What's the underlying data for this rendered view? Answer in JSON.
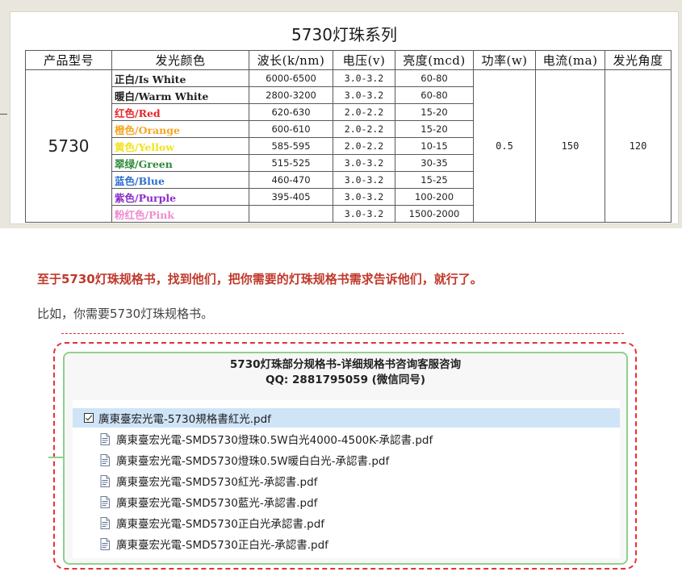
{
  "spec_table": {
    "title": "5730灯珠系列",
    "headers": [
      "产品型号",
      "发光颜色",
      "波长(k/nm)",
      "电压(v)",
      "亮度(mcd)",
      "功率(w)",
      "电流(ma)",
      "发光角度"
    ],
    "model": "5730",
    "power": "0.5",
    "current": "150",
    "angle": "120",
    "rows": [
      {
        "color": "正白/Is White",
        "color_hex": "#222222",
        "wavelength": "6000-6500",
        "voltage": "3.0-3.2",
        "brightness": "60-80"
      },
      {
        "color": "暖白/Warm White",
        "color_hex": "#222222",
        "wavelength": "2800-3200",
        "voltage": "3.0-3.2",
        "brightness": "60-80"
      },
      {
        "color": "红色/Red",
        "color_hex": "#e8262a",
        "wavelength": "620-630",
        "voltage": "2.0-2.2",
        "brightness": "15-20"
      },
      {
        "color": "橙色/Orange",
        "color_hex": "#f5a623",
        "wavelength": "600-610",
        "voltage": "2.0-2.2",
        "brightness": "15-20"
      },
      {
        "color": "黄色/Yellow",
        "color_hex": "#f2e31b",
        "wavelength": "585-595",
        "voltage": "2.0-2.2",
        "brightness": "10-15"
      },
      {
        "color": "翠绿/Green",
        "color_hex": "#2e8b3a",
        "wavelength": "515-525",
        "voltage": "3.0-3.2",
        "brightness": "30-35"
      },
      {
        "color": "蓝色/Blue",
        "color_hex": "#2f6fcf",
        "wavelength": "460-470",
        "voltage": "3.0-3.2",
        "brightness": "15-25"
      },
      {
        "color": "紫色/Purple",
        "color_hex": "#8b2fc9",
        "wavelength": "395-405",
        "voltage": "3.0-3.2",
        "brightness": "100-200"
      },
      {
        "color": "粉红色/Pink",
        "color_hex": "#f08ad0",
        "wavelength": "",
        "voltage": "3.0-3.2",
        "brightness": "1500-2000"
      }
    ]
  },
  "highlight_text": "至于5730灯珠规格书，找到他们，把你需要的灯珠规格书需求告诉他们，就行了。",
  "body_text": "比如，你需要5730灯珠规格书。",
  "file_panel": {
    "title": "5730灯珠部分规格书-详细规格书咨询客服咨询",
    "contact": "QQ:  2881795059  (微信同号)",
    "files": [
      {
        "name": "廣東臺宏光電-5730規格書紅光.pdf",
        "selected": true
      },
      {
        "name": "廣東臺宏光電-SMD5730燈珠0.5W白光4000-4500K-承認書.pdf",
        "selected": false
      },
      {
        "name": "廣東臺宏光電-SMD5730燈珠0.5W暖白白光-承認書.pdf",
        "selected": false
      },
      {
        "name": "廣東臺宏光電-SMD5730紅光-承認書.pdf",
        "selected": false
      },
      {
        "name": "廣東臺宏光電-SMD5730藍光-承認書.pdf",
        "selected": false
      },
      {
        "name": "廣東臺宏光電-SMD5730正白光承認書.pdf",
        "selected": false
      },
      {
        "name": "廣東臺宏光電-SMD5730正白光-承認書.pdf",
        "selected": false
      }
    ],
    "colors": {
      "dashed_border": "#e7303a",
      "inner_border": "#8fd18c",
      "selection": "#cfe4f7"
    }
  }
}
